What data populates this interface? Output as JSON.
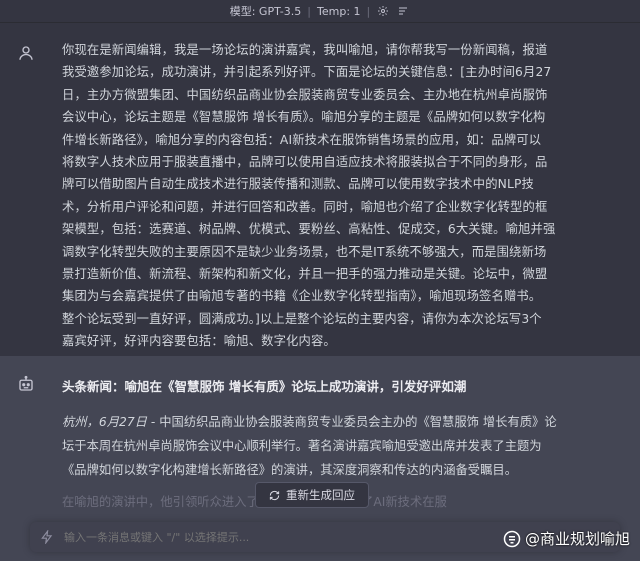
{
  "header": {
    "model_label": "模型: GPT-3.5",
    "separator": "|",
    "temp_label": "Temp: 1",
    "separator2": "|"
  },
  "user_message": {
    "lines": [
      "你现在是新闻编辑，我是一场论坛的演讲嘉宾，我叫喻旭，请你帮我写一份新闻稿，报道",
      "我受邀参加论坛，成功演讲，并引起系列好评。下面是论坛的关键信息：[主办时间6月27",
      "日，主办方微盟集团、中国纺织品商业协会服装商贸专业委员会、主办地在杭州卓尚服饰",
      "会议中心，论坛主题是《智慧服饰 增长有质》。喻旭分享的主题是《品牌如何以数字化构",
      "件增长新路径》，喻旭分享的内容包括：AI新技术在服饰销售场景的应用，如：品牌可以",
      "将数字人技术应用于服装直播中，品牌可以使用自适应技术将服装拟合于不同的身形，品",
      "牌可以借助图片自动生成技术进行服装传播和测款、品牌可以使用数字技术中的NLP技",
      "术，分析用户评论和问题，并进行回答和改善。同时，喻旭也介绍了企业数字化转型的框",
      "架模型，包括：选赛道、树品牌、优模式、要粉丝、高粘性、促成交，6大关键。喻旭并强",
      "调数字化转型失败的主要原因不是缺少业务场景，也不是IT系统不够强大，而是围绕新场",
      "景打造新价值、新流程、新架构和新文化，并且一把手的强力推动是关键。论坛中，微盟",
      "集团为与会嘉宾提供了由喻旭专著的书籍《企业数字化转型指南》，喻旭现场签名赠书。",
      "整个论坛受到一直好评，圆满成功。]以上是整个论坛的主要内容，请你为本次论坛写3个",
      "嘉宾好评，好评内容要包括：喻旭、数字化内容。"
    ]
  },
  "bot_message": {
    "title": "头条新闻：喻旭在《智慧服饰 增长有质》论坛上成功演讲，引发好评如潮",
    "body_lines": [
      "杭州，6月27日 - 中国纺织品商业协会服装商贸专业委员会主办的《智慧服饰 增长有质》论",
      "坛于本周在杭州卓尚服饰会议中心顺利举行。著名演讲嘉宾喻旭受邀出席并发表了主题为",
      "《品牌如何以数字化构建增长新路径》的演讲，其深度洞察和传达的内涵备受瞩目。"
    ],
    "body_line1_italic": "杭州，6月27日",
    "body_line1_rest": " - 中国纺织品商业协会服装商贸专业委员会主办的《智慧服饰 增长有质》论",
    "faded_line": "在喻旭的演讲中，他引领听众进入了                全新视角。他分享了AI新技术在服"
  },
  "regenerate_label": "重新生成回应",
  "input": {
    "placeholder": "输入一条消息或键入 \"/\" 以选择提示..."
  },
  "watermark": "@商业规划喻旭",
  "colors": {
    "background": "#343541",
    "bot_background": "#444654",
    "text": "#d1d5db",
    "input_bg": "#40414f"
  }
}
